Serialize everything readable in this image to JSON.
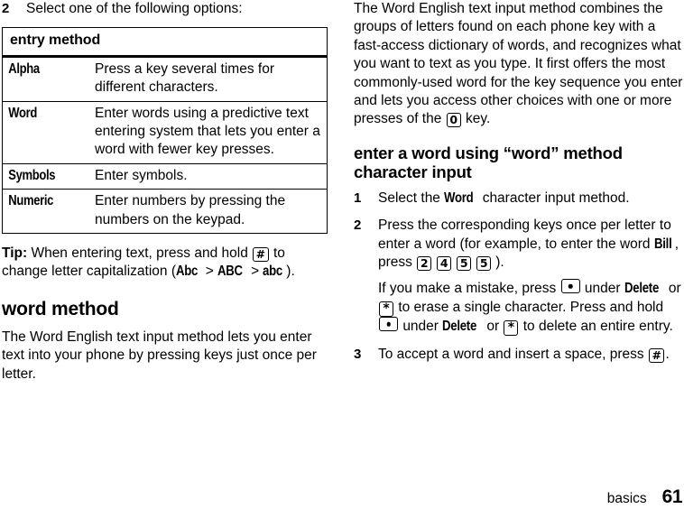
{
  "left_column": {
    "step2": {
      "number": "2",
      "text": "Select one of the following options:"
    },
    "table": {
      "header": "entry method",
      "rows": [
        {
          "method": "Alpha",
          "description": "Press a key several times for different characters."
        },
        {
          "method": "Word",
          "description": "Enter words using a predictive text entering system that lets you enter a word with fewer key presses."
        },
        {
          "method": "Symbols",
          "description": "Enter symbols."
        },
        {
          "method": "Numeric",
          "description": "Enter numbers by pressing the numbers on the keypad."
        }
      ]
    },
    "tip": {
      "label": "Tip:",
      "text_before_key": "When entering text, press and hold",
      "key": "#",
      "text_after_key": "to change letter capitalization (",
      "case1": "Abc",
      "sep1": ">",
      "case2": "ABC",
      "sep2": ">",
      "case3": "abc",
      "text_end": ")."
    },
    "section_heading": "word method",
    "paragraph": "The Word English text input method lets you enter text into your phone by pressing keys just once per letter."
  },
  "right_column": {
    "intro_before_key": "The Word English text input method combines the groups of letters found on each phone key with a fast-access dictionary of words, and recognizes what you want to text as you type. It first offers the most commonly-used word for the key sequence you enter and lets you access other choices with one or more presses of the",
    "intro_key": "0",
    "intro_after_key": "key.",
    "section_heading_line1": "enter a word using “word” method",
    "section_heading_line2": "character input",
    "steps": [
      {
        "number": "1",
        "text_before": "Select the",
        "menu_item": "Word",
        "text_after": "character input method."
      },
      {
        "number": "2",
        "para1_before": "Press the corresponding keys once per letter to enter a word (for example, to enter the word",
        "para1_word": "Bill",
        "para1_mid": ", press",
        "keys": [
          "2",
          "4",
          "5",
          "5"
        ],
        "para1_end": ").",
        "para2_a": "If you make a mistake, press",
        "para2_softkey": "softkey-dot",
        "para2_b": "under",
        "para2_delete1": "Delete",
        "para2_c": "or",
        "para2_star1": "*",
        "para2_d": "to erase a single character. Press and hold",
        "para2_e": "under",
        "para2_delete2": "Delete",
        "para2_f": "or",
        "para2_star2": "*",
        "para2_g": "to delete an entire entry."
      },
      {
        "number": "3",
        "text_before": "To accept a word and insert a space, press",
        "key": "#",
        "text_after": "."
      }
    ]
  },
  "footer": {
    "section": "basics",
    "page": "61"
  }
}
